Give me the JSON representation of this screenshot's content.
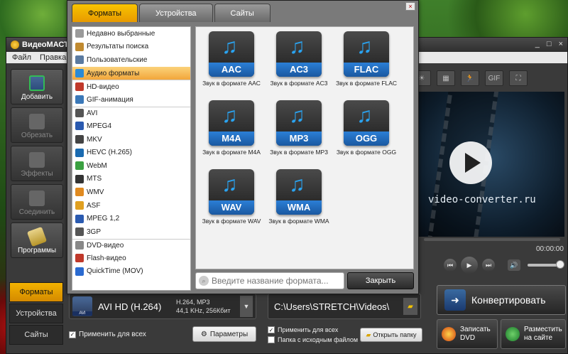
{
  "app": {
    "title": "ВидеоМАСТ",
    "window_controls": [
      "_",
      "□",
      "×"
    ],
    "menu": [
      "Файл",
      "Правка"
    ]
  },
  "sidebar": {
    "items": [
      {
        "label": "Добавить",
        "icon": "film-add-icon"
      },
      {
        "label": "Обрезать",
        "icon": "scissors-icon"
      },
      {
        "label": "Эффекты",
        "icon": "effects-icon"
      },
      {
        "label": "Соединить",
        "icon": "join-icon"
      },
      {
        "label": "Программы",
        "icon": "programs-icon"
      }
    ]
  },
  "bottom_tabs": [
    "Форматы",
    "Устройства",
    "Сайты"
  ],
  "player_toolbar": [
    "☀",
    "▦",
    "🏃",
    "GIF",
    "⛶"
  ],
  "preview": {
    "watermark": "video-converter.ru",
    "time": "00:00:00",
    "controls": [
      "⏮",
      "▶",
      "⏭"
    ],
    "volume_icon": "🔊"
  },
  "output": {
    "format_name": "AVI HD (H.264)",
    "format_thumb_label": "AVI",
    "specs_line1": "H.264, MP3",
    "specs_line2": "44,1 KHz, 256Кбит",
    "apply_all_format": "Применить для всех",
    "params_button": "Параметры",
    "path": "C:\\Users\\STRETCH\\Videos\\",
    "apply_all_path": "Применить для всех",
    "source_folder": "Папка с исходным файлом",
    "open_folder_button": "Открыть папку",
    "convert_button": "Конвертировать",
    "burn_dvd": [
      "Записать",
      "DVD"
    ],
    "publish": [
      "Разместить",
      "на сайте"
    ]
  },
  "dialog": {
    "tabs": [
      "Форматы",
      "Устройства",
      "Сайты"
    ],
    "active_tab": 0,
    "close_x": "×",
    "categories": [
      {
        "label": "Недавно выбранные",
        "icon": "recent-icon",
        "color": "#9a9a9a"
      },
      {
        "label": "Результаты поиска",
        "icon": "search-results-icon",
        "color": "#c08a30"
      },
      {
        "label": "Пользовательские",
        "icon": "user-icon",
        "color": "#5a7aa0"
      },
      {
        "label": "Аудио форматы",
        "icon": "audio-note-icon",
        "color": "#2a8ad6",
        "selected": true
      },
      {
        "label": "HD-видео",
        "icon": "hd-icon",
        "color": "#c0392b",
        "sep": true
      },
      {
        "label": "GIF-анимация",
        "icon": "gif-icon",
        "color": "#3a78b8"
      },
      {
        "label": "AVI",
        "icon": "avi-icon",
        "color": "#555555",
        "sep": true
      },
      {
        "label": "MPEG4",
        "icon": "mpeg4-icon",
        "color": "#2a5ab0"
      },
      {
        "label": "MKV",
        "icon": "mkv-icon",
        "color": "#444444"
      },
      {
        "label": "HEVC (H.265)",
        "icon": "hevc-icon",
        "color": "#1a6ab0"
      },
      {
        "label": "WebM",
        "icon": "webm-icon",
        "color": "#3aa040"
      },
      {
        "label": "MTS",
        "icon": "mts-icon",
        "color": "#333333"
      },
      {
        "label": "WMV",
        "icon": "wmv-icon",
        "color": "#e08a20"
      },
      {
        "label": "ASF",
        "icon": "asf-icon",
        "color": "#e0a020"
      },
      {
        "label": "MPEG 1,2",
        "icon": "mpeg12-icon",
        "color": "#2a5ab0"
      },
      {
        "label": "3GP",
        "icon": "3gp-icon",
        "color": "#555555"
      },
      {
        "label": "DVD-видео",
        "icon": "dvd-icon",
        "color": "#888888",
        "sep": true
      },
      {
        "label": "Flash-видео",
        "icon": "flash-icon",
        "color": "#c0392b"
      },
      {
        "label": "QuickTime (MOV)",
        "icon": "quicktime-icon",
        "color": "#2a6ad0"
      }
    ],
    "formats": [
      {
        "name": "AAC",
        "caption": "Звук в формате AAC"
      },
      {
        "name": "AC3",
        "caption": "Звук в формате AC3"
      },
      {
        "name": "FLAC",
        "caption": "Звук в формате FLAC"
      },
      {
        "name": "M4A",
        "caption": "Звук в формате M4A"
      },
      {
        "name": "MP3",
        "caption": "Звук в формате MP3"
      },
      {
        "name": "OGG",
        "caption": "Звук в формате OGG"
      },
      {
        "name": "WAV",
        "caption": "Звук в формате WAV"
      },
      {
        "name": "WMA",
        "caption": "Звук в формате WMA"
      }
    ],
    "search_placeholder": "Введите название формата...",
    "close_button": "Закрыть"
  }
}
